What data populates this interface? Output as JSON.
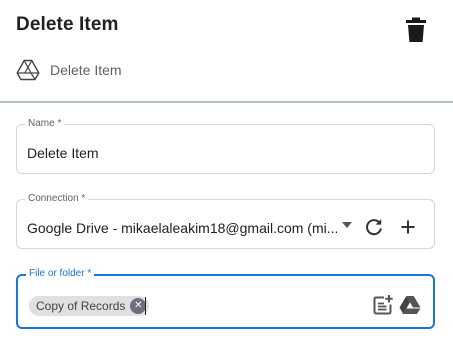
{
  "header": {
    "title": "Delete Item"
  },
  "subheader": {
    "app_icon": "google-drive-outline-icon",
    "label": "Delete Item"
  },
  "form": {
    "name": {
      "label": "Name *",
      "value": "Delete Item"
    },
    "connection": {
      "label": "Connection *",
      "value": "Google Drive - mikaelaleakim18@gmail.com (mi..."
    },
    "file_or_folder": {
      "label": "File or folder *",
      "chip_label": "Copy of Records"
    }
  },
  "colors": {
    "accent": "#1976d2",
    "divider": "#b0bec5",
    "border": "#d6d6d6",
    "chip_bg": "#e0e0e0"
  }
}
